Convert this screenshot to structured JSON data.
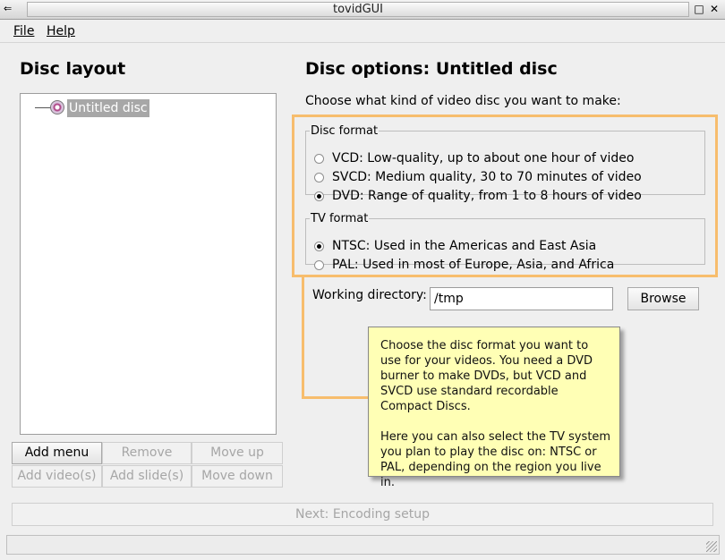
{
  "window": {
    "title": "tovidGUI"
  },
  "menubar": {
    "file": "File",
    "help": "Help"
  },
  "left": {
    "title": "Disc layout",
    "tree": {
      "item": "Untitled disc"
    },
    "buttons": {
      "add_menu": "Add menu",
      "remove": "Remove",
      "move_up": "Move up",
      "add_videos": "Add video(s)",
      "add_slides": "Add slide(s)",
      "move_down": "Move down"
    }
  },
  "right": {
    "title": "Disc options: Untitled disc",
    "prompt": "Choose what kind of video disc you want to make:",
    "disc_format": {
      "legend": "Disc format",
      "options": [
        {
          "label": "VCD: Low-quality, up to about one hour of video",
          "selected": false
        },
        {
          "label": "SVCD: Medium quality, 30 to 70 minutes of video",
          "selected": false
        },
        {
          "label": "DVD: Range of quality, from 1 to 8 hours of video",
          "selected": true
        }
      ]
    },
    "tv_format": {
      "legend": "TV format",
      "options": [
        {
          "label": "NTSC: Used in the Americas and East Asia",
          "selected": true
        },
        {
          "label": "PAL: Used in most of Europe, Asia, and Africa",
          "selected": false
        }
      ]
    },
    "working_dir": {
      "label": "Working directory:",
      "value": "/tmp",
      "browse": "Browse"
    }
  },
  "tooltip": {
    "p1": "Choose the disc format you want to use for your videos. You need a DVD burner to make DVDs, but VCD and SVCD use standard recordable Compact Discs.",
    "p2": "Here you can also select the TV system you plan to play the disc on: NTSC or PAL, depending on the region you live in."
  },
  "footer": {
    "next": "Next: Encoding setup"
  },
  "colors": {
    "highlight": "#f7bd6d",
    "tooltip_bg": "#ffffb5"
  }
}
